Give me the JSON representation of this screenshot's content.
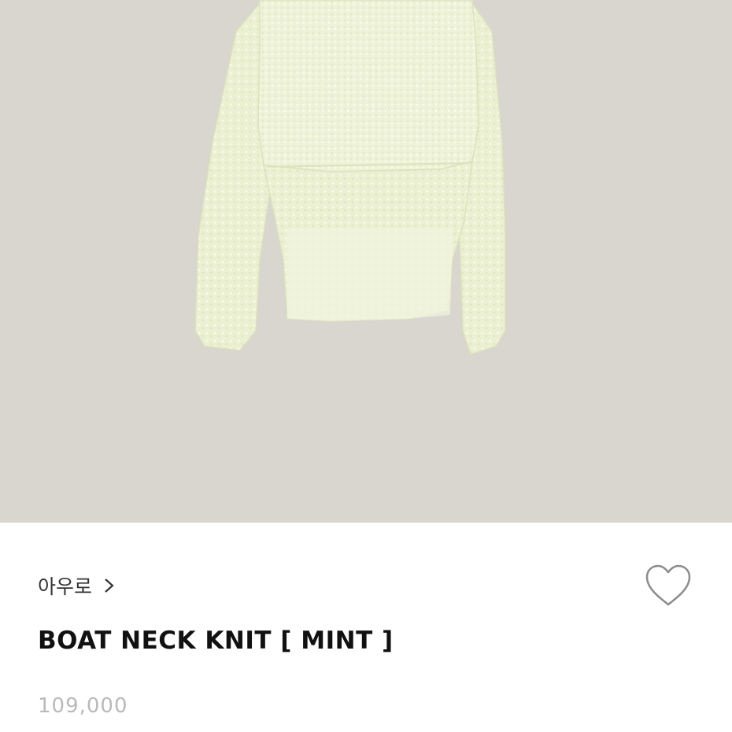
{
  "product": {
    "brand": "아우로",
    "title": "BOAT NECK KNIT [ MINT ]",
    "price": "109,000"
  },
  "icons": {
    "brand_chevron": "chevron-right-icon",
    "wishlist": "heart-outline-icon"
  },
  "colors": {
    "image_background": "#d9d5cf",
    "knit": "#ecf0d2",
    "title": "#111111",
    "price": "#b9b9b9"
  }
}
